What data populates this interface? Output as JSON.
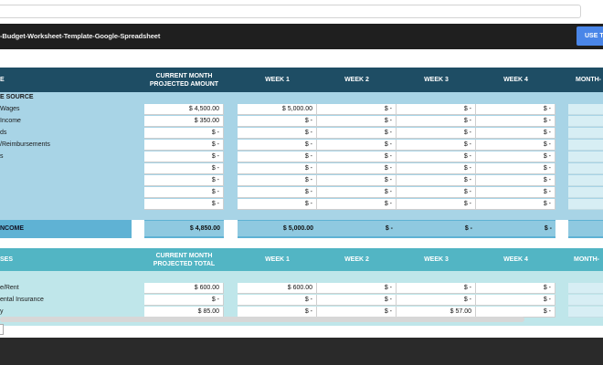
{
  "doc": {
    "title": "-Budget-Worksheet-Template-Google-Spreadsheet",
    "use_button": "USE T"
  },
  "income": {
    "header": {
      "label": "E",
      "col_projected": "CURRENT MONTH\nPROJECTED AMOUNT",
      "weeks": [
        "WEEK 1",
        "WEEK 2",
        "WEEK 3",
        "WEEK 4"
      ],
      "month_partial": "MONTH-"
    },
    "section_label": "E SOURCE",
    "rows": [
      {
        "label": "Wages",
        "projected": "$ 4,500.00",
        "w1": "$ 5,000.00",
        "w2": "$ -",
        "w3": "$ -",
        "w4": "$ -"
      },
      {
        "label": "Income",
        "projected": "$ 350.00",
        "w1": "$ -",
        "w2": "$ -",
        "w3": "$ -",
        "w4": "$ -"
      },
      {
        "label": "ds",
        "projected": "$ -",
        "w1": "$ -",
        "w2": "$ -",
        "w3": "$ -",
        "w4": "$ -"
      },
      {
        "label": "/Reimbursements",
        "projected": "$ -",
        "w1": "$ -",
        "w2": "$ -",
        "w3": "$ -",
        "w4": "$ -"
      },
      {
        "label": "s",
        "projected": "$ -",
        "w1": "$ -",
        "w2": "$ -",
        "w3": "$ -",
        "w4": "$ -"
      },
      {
        "label": "",
        "projected": "$ -",
        "w1": "$ -",
        "w2": "$ -",
        "w3": "$ -",
        "w4": "$ -"
      },
      {
        "label": "",
        "projected": "$ -",
        "w1": "$ -",
        "w2": "$ -",
        "w3": "$ -",
        "w4": "$ -"
      },
      {
        "label": "",
        "projected": "$ -",
        "w1": "$ -",
        "w2": "$ -",
        "w3": "$ -",
        "w4": "$ -"
      },
      {
        "label": "",
        "projected": "$ -",
        "w1": "$ -",
        "w2": "$ -",
        "w3": "$ -",
        "w4": "$ -"
      }
    ],
    "total": {
      "label": "NCOME",
      "projected": "$ 4,850.00",
      "w1": "$ 5,000.00",
      "w2": "$ -",
      "w3": "$ -",
      "w4": "$ -"
    }
  },
  "expenses": {
    "header": {
      "label": "SES",
      "col_projected": "CURRENT MONTH\nPROJECTED TOTAL",
      "weeks": [
        "WEEK 1",
        "WEEK 2",
        "WEEK 3",
        "WEEK 4"
      ],
      "month_partial": "MONTH-"
    },
    "rows": [
      {
        "label": "e/Rent",
        "projected": "$ 600.00",
        "w1": "$ 600.00",
        "w2": "$ -",
        "w3": "$ -",
        "w4": "$ -"
      },
      {
        "label": "ental Insurance",
        "projected": "$ -",
        "w1": "$ -",
        "w2": "$ -",
        "w3": "$ -",
        "w4": "$ -"
      },
      {
        "label": "y",
        "projected": "$ 85.00",
        "w1": "$ -",
        "w2": "$ -",
        "w3": "$ 57.00",
        "w4": "$ -"
      }
    ]
  },
  "colors": {
    "header_dark": "#1e4d64",
    "band_light": "#a8d4e6",
    "total_band": "#5fb2d4",
    "exp_header": "#52b5c4",
    "exp_band": "#bfe6ea",
    "accent_button": "#4a86e8"
  }
}
